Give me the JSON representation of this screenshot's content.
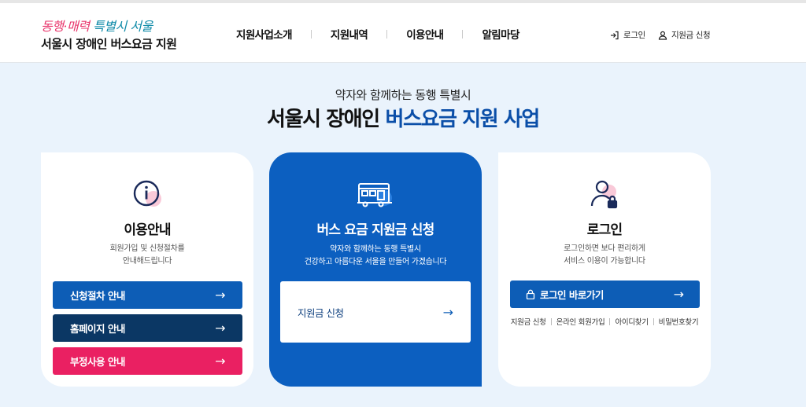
{
  "header": {
    "slogan_part1": "동행·매력",
    "slogan_part2": "특별시 서울",
    "site_title": "서울시 장애인 버스요금 지원",
    "nav": [
      "지원사업소개",
      "지원내역",
      "이용안내",
      "알림마당"
    ],
    "util_login": "로그인",
    "util_apply": "지원금 신청"
  },
  "hero": {
    "subtitle": "약자와 함께하는 동행 특별시",
    "title_plain": "서울시 장애인 ",
    "title_highlight": "버스요금 지원 사업"
  },
  "cards": {
    "guide": {
      "title": "이용안내",
      "desc_line1": "회원가입 및 신청절차를",
      "desc_line2": "안내해드립니다",
      "buttons": [
        "신청절차 안내",
        "홈페이지 안내",
        "부정사용 안내"
      ]
    },
    "apply": {
      "title": "버스 요금 지원금 신청",
      "desc_line1": "약자와 함께하는 동행 특별시",
      "desc_line2": "건강하고 아름다운 서울을 만들어 가겠습니다",
      "button": "지원금 신청"
    },
    "login": {
      "title": "로그인",
      "desc_line1": "로그인하면 보다 편리하게",
      "desc_line2": "서비스 이용이 가능합니다",
      "button": "로그인 바로가기",
      "links": [
        "지원금 신청",
        "온라인 회원가입",
        "아이디찾기",
        "비밀번호찾기"
      ]
    }
  },
  "colors": {
    "primary_blue": "#0d5db6",
    "navy": "#0b3764",
    "pink": "#ea2062",
    "background": "#eaf3fc"
  },
  "icons": {
    "arrow": "→",
    "info": "info-circle-icon",
    "bus": "bus-icon",
    "user_lock": "user-lock-icon"
  }
}
